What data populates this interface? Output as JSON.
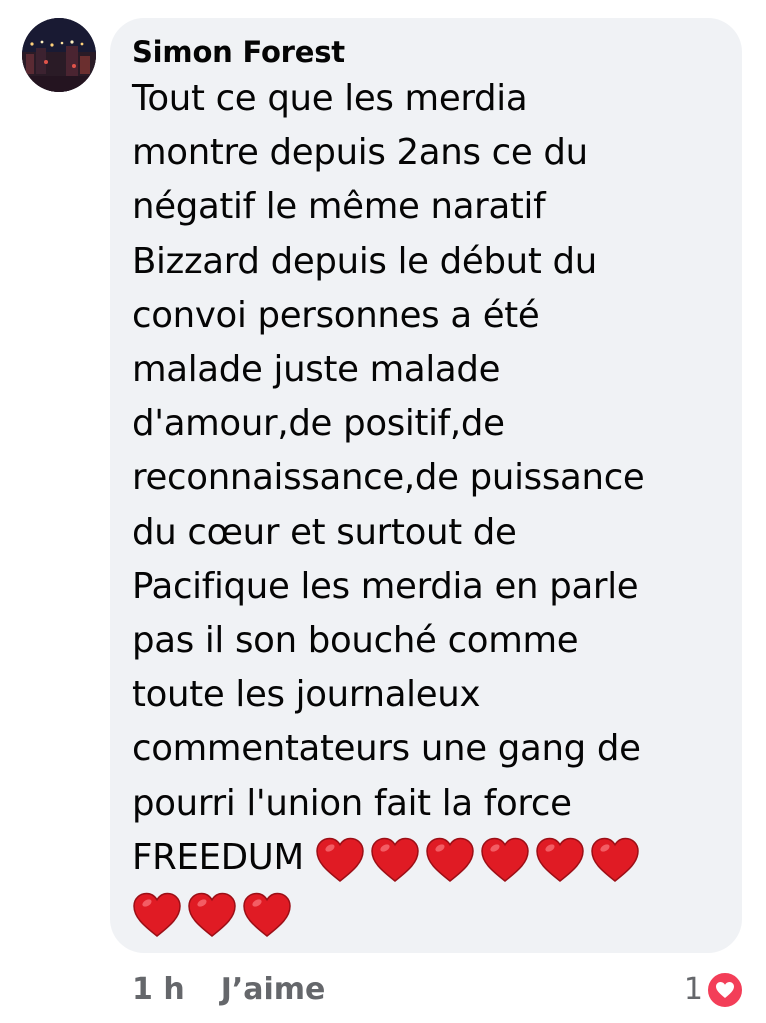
{
  "comment": {
    "author": "Simon Forest",
    "avatar_icon": "profile-photo-night-city",
    "lines": [
      "Tout ce que les merdia",
      "montre depuis 2ans ce du",
      "négatif le même naratif",
      "Bizzard depuis le début du",
      "convoi personnes a été",
      "malade juste malade",
      "d'amour,de positif,de",
      "reconnaissance,de puissance",
      "du cœur et surtout de",
      "Pacifique les merdia en parle",
      "pas il son bouché comme",
      "toute les journaleux",
      "commentateurs une gang de",
      "pourri l'union fait la force"
    ],
    "last_line_text": "FREEDUM",
    "heart_emoji": "❤️",
    "hearts_after_text": 6,
    "hearts_next_line": 3
  },
  "footer": {
    "timestamp": "1 h",
    "like_label": "J’aime"
  },
  "reactions": {
    "count": "1",
    "icon": "love-reaction-icon",
    "color": "#f33e58"
  },
  "colors": {
    "bubble": "#f0f2f5",
    "text": "#050505",
    "secondary": "#65676b",
    "heart": "#e01b24"
  }
}
